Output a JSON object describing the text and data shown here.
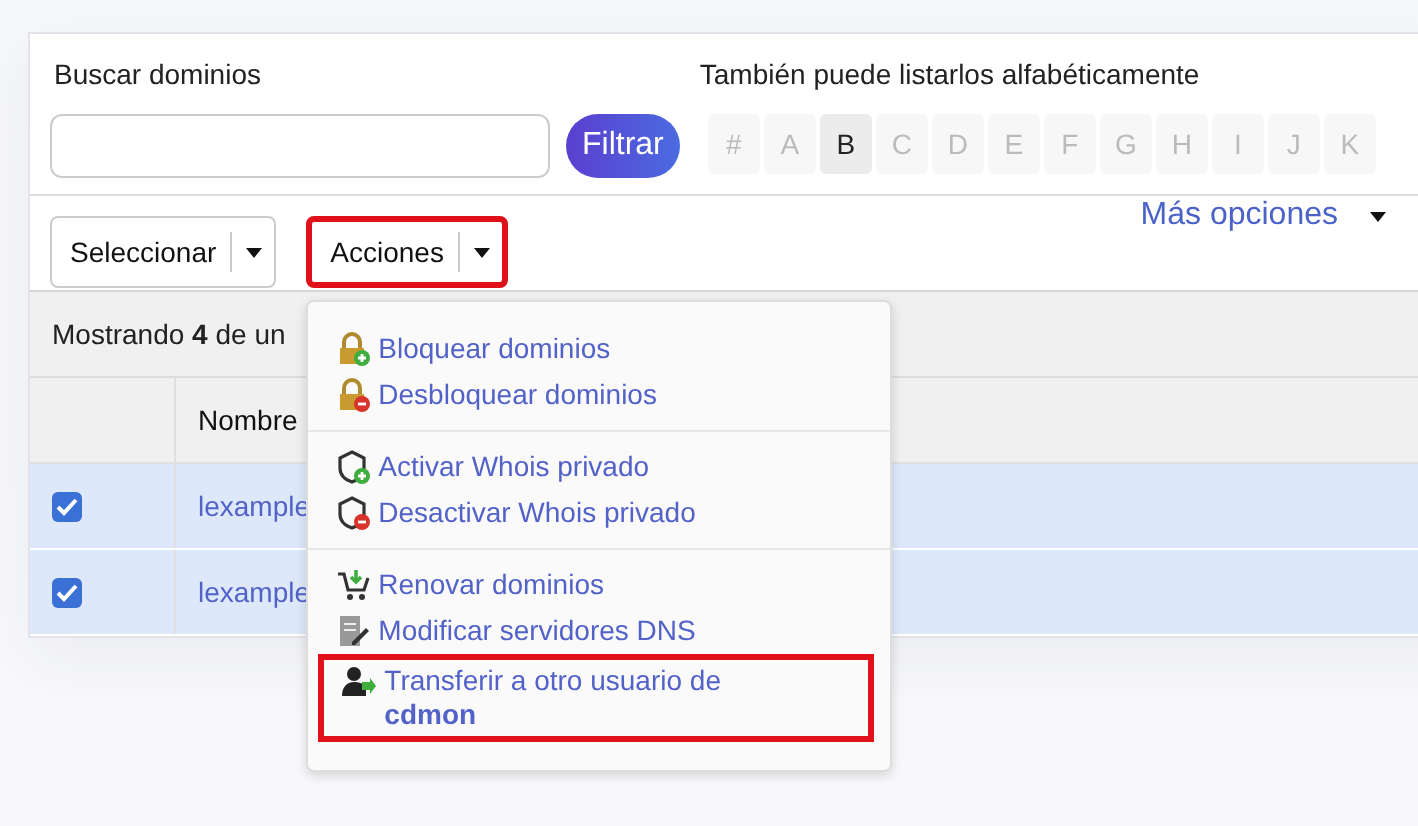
{
  "search": {
    "label": "Buscar dominios",
    "button": "Filtrar"
  },
  "alphabet": {
    "label": "También puede listarlos alfabéticamente",
    "letters": [
      {
        "label": "#",
        "selected": false
      },
      {
        "label": "A",
        "selected": false
      },
      {
        "label": "B",
        "selected": true
      },
      {
        "label": "C",
        "selected": false
      },
      {
        "label": "D",
        "selected": false
      },
      {
        "label": "E",
        "selected": false
      },
      {
        "label": "F",
        "selected": false
      },
      {
        "label": "G",
        "selected": false
      },
      {
        "label": "H",
        "selected": false
      },
      {
        "label": "I",
        "selected": false
      },
      {
        "label": "J",
        "selected": false
      },
      {
        "label": "K",
        "selected": false
      }
    ]
  },
  "toolbar": {
    "select_button": {
      "label": "Seleccionar",
      "highlighted": false
    },
    "actions_button": {
      "label": "Acciones",
      "highlighted": true
    },
    "more_options": "Más opciones"
  },
  "table": {
    "summary": "Mostrando **4** de un",
    "columns": [
      "",
      "Nombre"
    ],
    "rows": [
      {
        "checked": true,
        "name": "lexample"
      },
      {
        "checked": true,
        "name": "lexample"
      }
    ]
  },
  "actions_menu": {
    "groups": [
      {
        "items": [
          {
            "label": "Bloquear dominios",
            "highlighted": false
          },
          {
            "label": "Desbloquear dominios",
            "highlighted": false
          }
        ]
      },
      {
        "items": [
          {
            "label": "Activar Whois privado",
            "highlighted": false
          },
          {
            "label": "Desactivar Whois privado",
            "highlighted": false
          }
        ]
      },
      {
        "items": [
          {
            "label": "Renovar dominios",
            "highlighted": false
          },
          {
            "label": "Modificar servidores DNS",
            "highlighted": false
          },
          {
            "label": "Transferir a otro usuario de **cdmon**",
            "highlighted": true
          }
        ]
      }
    ]
  }
}
